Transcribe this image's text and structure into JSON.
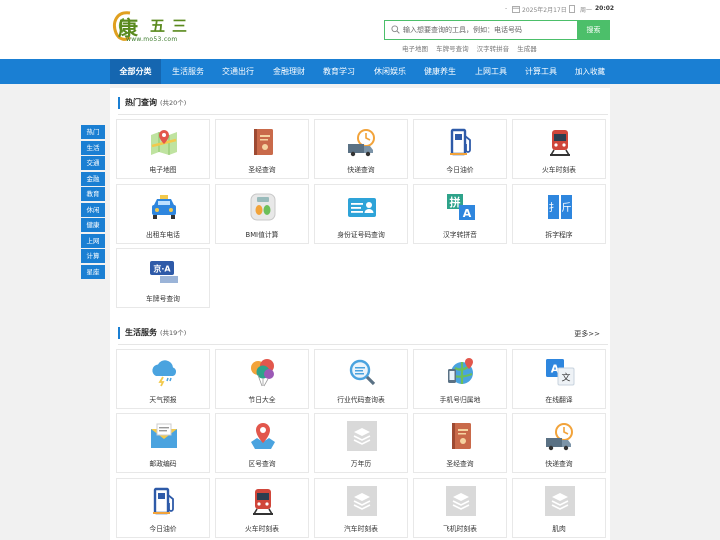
{
  "header": {
    "logo_chars": [
      "康",
      "五",
      "三"
    ],
    "logo_url": "www.mo53.com",
    "date_dash": "-",
    "date": "2025年2月17日",
    "weekday": "周一",
    "time": "20:02"
  },
  "search": {
    "placeholder": "输入想要查询的工具，例如：电话号码",
    "button": "搜索",
    "hotwords": [
      "电子地图",
      "车牌号查询",
      "汉字转拼音",
      "生成器"
    ]
  },
  "nav": {
    "items": [
      "全部分类",
      "生活服务",
      "交通出行",
      "金融理财",
      "教育学习",
      "休闲娱乐",
      "健康养生",
      "上网工具",
      "计算工具",
      "加入收藏"
    ]
  },
  "sidenav": {
    "items": [
      "热门",
      "生活",
      "交通",
      "金融",
      "教育",
      "休闲",
      "健康",
      "上网",
      "计算",
      "星座"
    ]
  },
  "sections": {
    "hot": {
      "title": "热门查询",
      "count": "(共20个)",
      "tiles": [
        {
          "label": "电子地图",
          "icon": "map-icon"
        },
        {
          "label": "圣经查询",
          "icon": "bible-book-icon"
        },
        {
          "label": "快递查询",
          "icon": "delivery-truck-icon"
        },
        {
          "label": "今日油价",
          "icon": "fuel-pump-icon"
        },
        {
          "label": "火车时刻表",
          "icon": "train-icon"
        },
        {
          "label": "出租车电话",
          "icon": "taxi-icon"
        },
        {
          "label": "BMI值计算",
          "icon": "scale-icon"
        },
        {
          "label": "身份证号码查询",
          "icon": "id-card-icon"
        },
        {
          "label": "汉字转拼音",
          "icon": "pinyin-icon"
        },
        {
          "label": "拆字程序",
          "icon": "split-char-icon"
        },
        {
          "label": "车牌号查询",
          "icon": "license-plate-icon"
        }
      ]
    },
    "life": {
      "title": "生活服务",
      "count": "(共19个)",
      "more": "更多>>",
      "tiles": [
        {
          "label": "天气预报",
          "icon": "weather-icon"
        },
        {
          "label": "节日大全",
          "icon": "balloon-icon"
        },
        {
          "label": "行业代码查询表",
          "icon": "magnifier-doc-icon"
        },
        {
          "label": "手机号归属地",
          "icon": "phone-location-icon"
        },
        {
          "label": "在线翻译",
          "icon": "translate-icon"
        },
        {
          "label": "邮政编码",
          "icon": "mail-icon"
        },
        {
          "label": "区号查询",
          "icon": "area-code-icon"
        },
        {
          "label": "万年历",
          "icon": "placeholder-icon"
        },
        {
          "label": "圣经查询",
          "icon": "bible-book-icon"
        },
        {
          "label": "快递查询",
          "icon": "delivery-truck-icon"
        },
        {
          "label": "今日油价",
          "icon": "fuel-pump-icon"
        },
        {
          "label": "火车时刻表",
          "icon": "train-icon"
        },
        {
          "label": "汽车时刻表",
          "icon": "placeholder-icon"
        },
        {
          "label": "飞机时刻表",
          "icon": "placeholder-icon"
        },
        {
          "label": "肌肉",
          "icon": "placeholder-icon"
        }
      ]
    }
  }
}
